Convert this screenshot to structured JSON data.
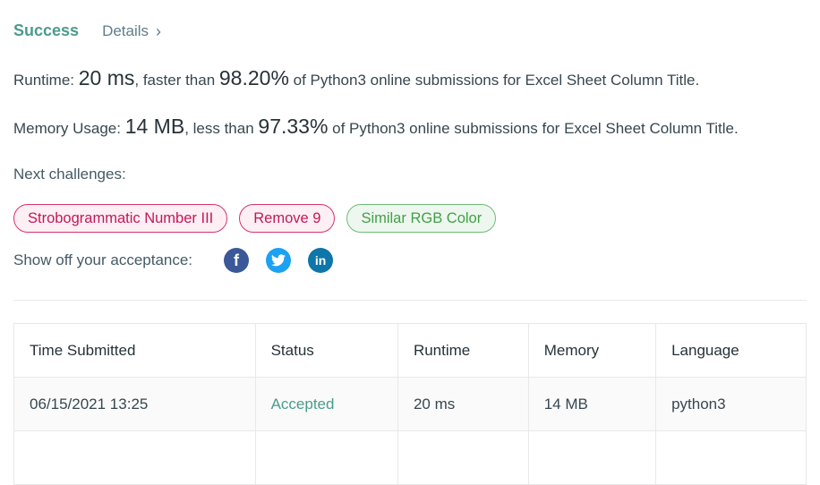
{
  "header": {
    "status": "Success",
    "details_label": "Details",
    "details_chevron": "›"
  },
  "runtime": {
    "label": "Runtime: ",
    "value": "20 ms",
    "comparison": ", faster than ",
    "percent": "98.20%",
    "suffix": " of Python3 online submissions for Excel Sheet Column Title."
  },
  "memory": {
    "label": "Memory Usage: ",
    "value": "14 MB",
    "comparison": ", less than ",
    "percent": "97.33%",
    "suffix": " of Python3 online submissions for Excel Sheet Column Title."
  },
  "next_challenges": {
    "label": "Next challenges:",
    "items": [
      {
        "label": "Strobogrammatic Number III",
        "difficulty_color": "#d6336c"
      },
      {
        "label": "Remove 9",
        "difficulty_color": "#d6336c"
      },
      {
        "label": "Similar RGB Color",
        "difficulty_color": "#6cbc74"
      }
    ]
  },
  "share": {
    "label": "Show off your acceptance:",
    "icons": [
      {
        "name": "facebook-icon",
        "glyph": "f"
      },
      {
        "name": "twitter-icon"
      },
      {
        "name": "linkedin-icon",
        "glyph": "in"
      }
    ]
  },
  "submissions": {
    "columns": [
      "Time Submitted",
      "Status",
      "Runtime",
      "Memory",
      "Language"
    ],
    "rows": [
      {
        "time": "06/15/2021 13:25",
        "status": "Accepted",
        "runtime": "20 ms",
        "memory": "14 MB",
        "language": "python3"
      }
    ]
  },
  "colors": {
    "success": "#4a9c8c",
    "hard_tag": "#d6336c",
    "easy_tag": "#6cbc74"
  }
}
